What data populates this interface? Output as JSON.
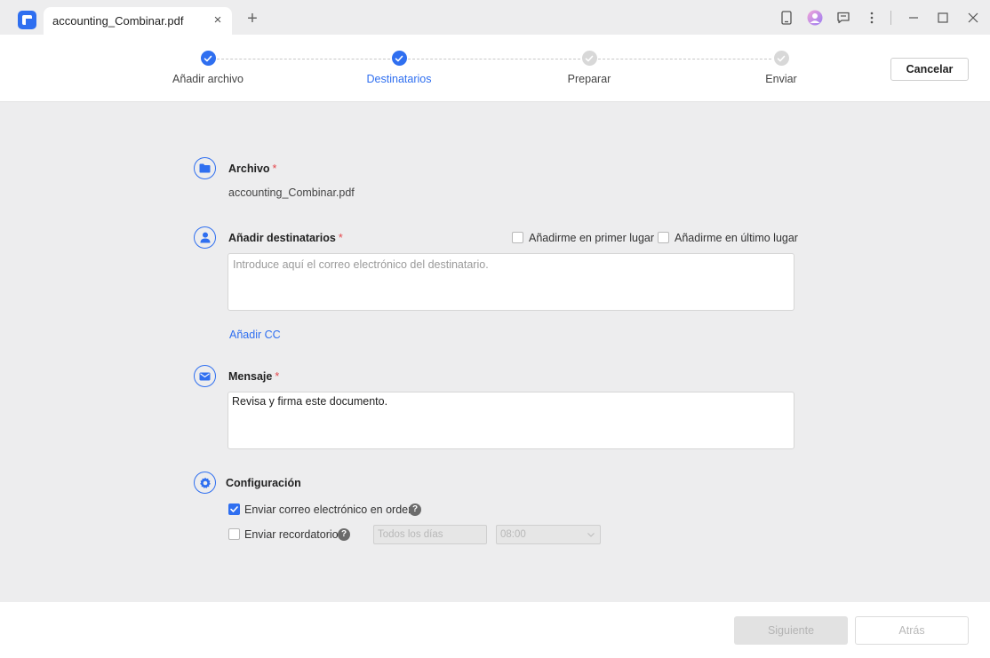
{
  "tab": {
    "title": "accounting_Combinar.pdf",
    "close": "×",
    "new_tab": "+"
  },
  "steps": [
    {
      "label": "Añadir archivo",
      "state": "done"
    },
    {
      "label": "Destinatarios",
      "state": "active"
    },
    {
      "label": "Preparar",
      "state": "todo"
    },
    {
      "label": "Enviar",
      "state": "todo"
    }
  ],
  "header": {
    "cancel_label": "Cancelar"
  },
  "file": {
    "title": "Archivo",
    "required": "*",
    "name": "accounting_Combinar.pdf"
  },
  "recipients": {
    "title": "Añadir destinatarios",
    "required": "*",
    "add_me_first": "Añadirme en primer lugar",
    "add_me_last": "Añadirme en último lugar",
    "placeholder": "Introduce aquí el correo electrónico del destinatario.",
    "add_cc": "Añadir CC"
  },
  "message": {
    "title": "Mensaje",
    "required": "*",
    "value": "Revisa y firma este documento."
  },
  "settings": {
    "title": "Configuración",
    "send_in_order": "Enviar correo electrónico en orden",
    "send_in_order_checked": true,
    "reminder": "Enviar recordatorio",
    "reminder_checked": false,
    "frequency": "Todos los días",
    "time": "08:00",
    "help": "?"
  },
  "footer": {
    "next_label": "Siguiente",
    "back_label": "Atrás"
  },
  "colors": {
    "accent": "#2f6ff0",
    "required": "#e5484d"
  }
}
